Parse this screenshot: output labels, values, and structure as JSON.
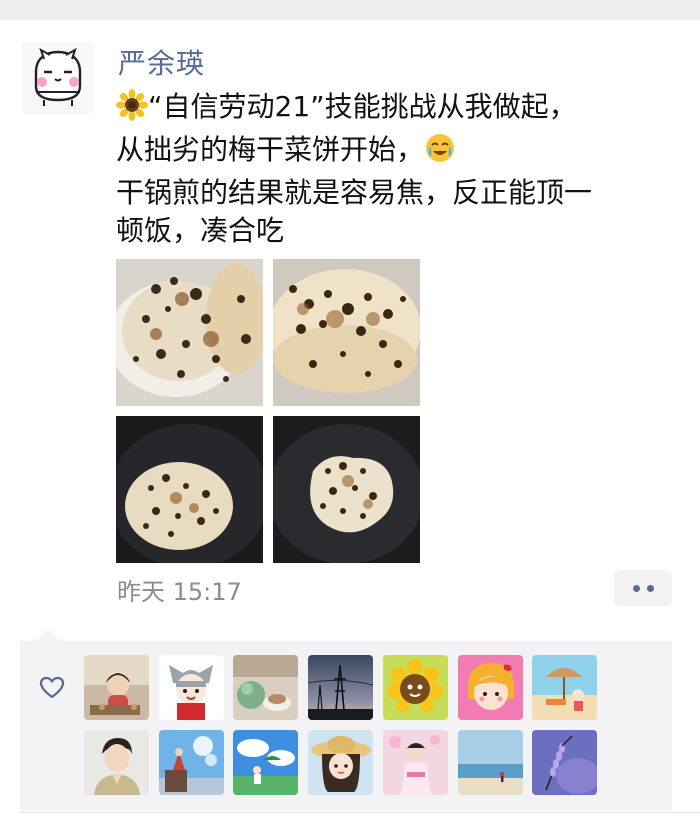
{
  "post": {
    "author": "严余瑛",
    "text_lines": [
      "“自信劳动21”技能挑战从我做起，",
      "从拙劣的梅干菜饼开始，",
      "干锅煎的结果就是容易焦，反正能顶一",
      "顿饭，凑合吃"
    ],
    "emojis": [
      "sunflower-emoji",
      "sob-laugh-emoji"
    ],
    "photos": [
      {
        "name": "pancakes-on-plate"
      },
      {
        "name": "charred-pancakes-stack"
      },
      {
        "name": "pancake-in-pan"
      },
      {
        "name": "pancake-in-pan-small"
      }
    ],
    "time": "昨天 15:17"
  },
  "likes": {
    "icon": "heart-outline-icon",
    "avatars": [
      "child-photo",
      "cat-hat-cartoon",
      "teacup-photo",
      "sunset-towers-photo",
      "sunflower-cartoon",
      "strawberry-girl-cartoon",
      "beach-umbrella-cartoon",
      "young-man-photo",
      "kids-bubbles-photo",
      "anime-sky-girl",
      "straw-hat-girl-cartoon",
      "kimono-girl-photo",
      "seaside-photo",
      "lavender-photo"
    ]
  },
  "colors": {
    "name_link": "#576b95",
    "text": "#111111",
    "meta": "#8c8c8c",
    "likes_bg": "#f3f3f5"
  }
}
